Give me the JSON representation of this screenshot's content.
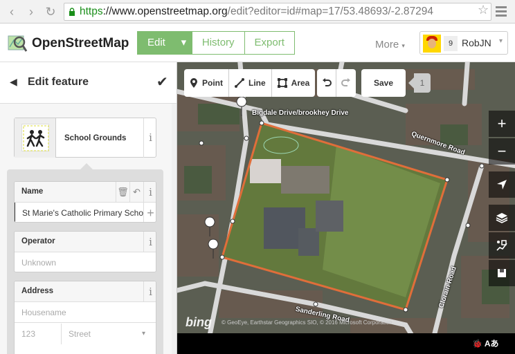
{
  "browser": {
    "url_scheme": "https",
    "url_host": "://www.openstreetmap.org",
    "url_path": "/edit?editor=id#map=17/53.48693/-2.87294"
  },
  "header": {
    "brand": "OpenStreetMap",
    "tabs": [
      "Edit",
      "History",
      "Export"
    ],
    "more": "More",
    "message_count": "9",
    "username": "RobJN"
  },
  "sidebar": {
    "title": "Edit feature",
    "preset": {
      "name": "School Grounds"
    },
    "fields": {
      "name": {
        "label": "Name",
        "value": "St Marie's Catholic Primary School"
      },
      "operator": {
        "label": "Operator",
        "placeholder": "Unknown"
      },
      "address": {
        "label": "Address",
        "housename_placeholder": "Housename",
        "housenumber_placeholder": "123",
        "street_placeholder": "Street"
      }
    }
  },
  "map": {
    "tools": {
      "point": "Point",
      "line": "Line",
      "area": "Area",
      "save": "Save",
      "edit_count": "1"
    },
    "labels": {
      "road1": "Bigdale Drive/brookhey Drive",
      "road2": "Quernmore Road",
      "road3": "Sanderling Road",
      "road4": "Clorain Road"
    },
    "attribution": "© GeoEye, Earthstar Geographics SIO, © 2016 Microsoft Corporation",
    "bing": "bing",
    "footer_lang": "Aあ"
  },
  "colors": {
    "osm_green": "#7ebc6f",
    "selection": "#e06e3a"
  }
}
